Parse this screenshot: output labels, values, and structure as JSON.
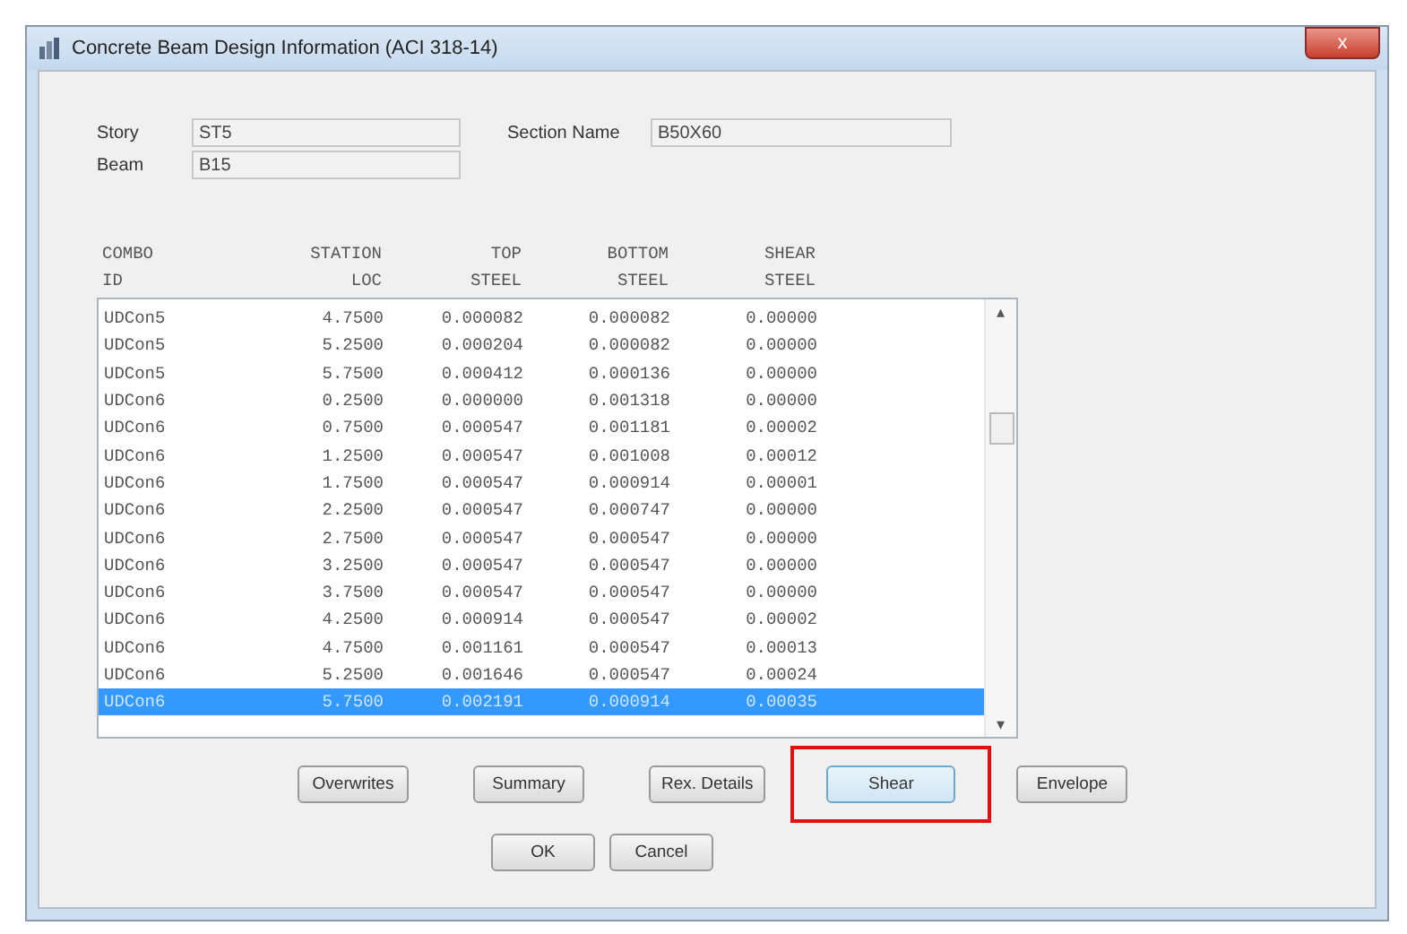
{
  "window": {
    "title": "Concrete Beam Design Information (ACI 318-14)",
    "close": "x"
  },
  "fields": [
    {
      "label": "Story",
      "value": "ST5"
    },
    {
      "label": "Beam",
      "value": "B15"
    }
  ],
  "section": {
    "label": "Section Name",
    "value": "B50X60"
  },
  "columns": [
    {
      "lines": [
        "COMBO",
        "ID"
      ]
    },
    {
      "lines": [
        "STATION",
        "LOC"
      ]
    },
    {
      "lines": [
        "TOP",
        "STEEL"
      ]
    },
    {
      "lines": [
        "BOTTOM",
        "STEEL"
      ]
    },
    {
      "lines": [
        "SHEAR",
        "STEEL"
      ]
    }
  ],
  "rows": [
    {
      "cells": [
        "UDCon5",
        "4.7500",
        "0.000082",
        "0.000082",
        "0.00000"
      ],
      "selected": false
    },
    {
      "cells": [
        "UDCon5",
        "5.2500",
        "0.000204",
        "0.000082",
        "0.00000"
      ],
      "selected": false
    },
    {
      "cells": [
        "UDCon5",
        "5.7500",
        "0.000412",
        "0.000136",
        "0.00000"
      ],
      "selected": false
    },
    {
      "cells": [
        "UDCon6",
        "0.2500",
        "0.000000",
        "0.001318",
        "0.00000"
      ],
      "selected": false
    },
    {
      "cells": [
        "UDCon6",
        "0.7500",
        "0.000547",
        "0.001181",
        "0.00002"
      ],
      "selected": false
    },
    {
      "cells": [
        "UDCon6",
        "1.2500",
        "0.000547",
        "0.001008",
        "0.00012"
      ],
      "selected": false
    },
    {
      "cells": [
        "UDCon6",
        "1.7500",
        "0.000547",
        "0.000914",
        "0.00001"
      ],
      "selected": false
    },
    {
      "cells": [
        "UDCon6",
        "2.2500",
        "0.000547",
        "0.000747",
        "0.00000"
      ],
      "selected": false
    },
    {
      "cells": [
        "UDCon6",
        "2.7500",
        "0.000547",
        "0.000547",
        "0.00000"
      ],
      "selected": false
    },
    {
      "cells": [
        "UDCon6",
        "3.2500",
        "0.000547",
        "0.000547",
        "0.00000"
      ],
      "selected": false
    },
    {
      "cells": [
        "UDCon6",
        "3.7500",
        "0.000547",
        "0.000547",
        "0.00000"
      ],
      "selected": false
    },
    {
      "cells": [
        "UDCon6",
        "4.2500",
        "0.000914",
        "0.000547",
        "0.00002"
      ],
      "selected": false
    },
    {
      "cells": [
        "UDCon6",
        "4.7500",
        "0.001161",
        "0.000547",
        "0.00013"
      ],
      "selected": false
    },
    {
      "cells": [
        "UDCon6",
        "5.2500",
        "0.001646",
        "0.000547",
        "0.00024"
      ],
      "selected": false
    },
    {
      "cells": [
        "UDCon6",
        "5.7500",
        "0.002191",
        "0.000914",
        "0.00035"
      ],
      "selected": true
    }
  ],
  "scrollbar": {
    "up": "▴",
    "down": "▾"
  },
  "buttons": [
    {
      "label": "Overwrites",
      "highlighted": false
    },
    {
      "label": "Summary",
      "highlighted": false
    },
    {
      "label": "Rex. Details",
      "highlighted": false
    },
    {
      "label": "Shear",
      "highlighted": true
    },
    {
      "label": "Envelope",
      "highlighted": false
    }
  ],
  "footer_buttons": [
    "OK",
    "Cancel"
  ]
}
